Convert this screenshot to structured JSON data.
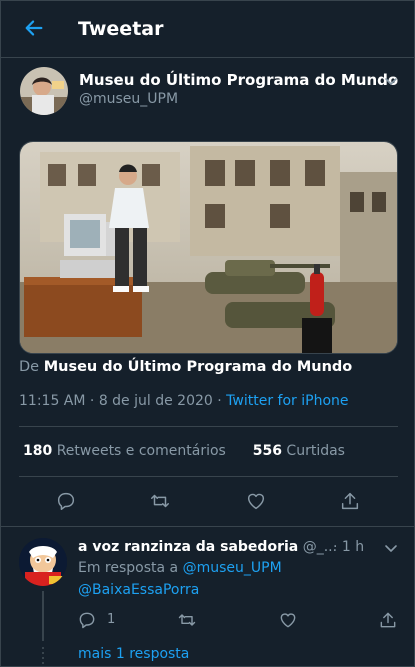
{
  "colors": {
    "background": "#15202b",
    "accent": "#1da1f2",
    "muted": "#8899a6",
    "border": "#38444d"
  },
  "header": {
    "back_icon": "arrow-left-icon",
    "title": "Tweetar"
  },
  "tweet": {
    "author_name": "Museu do Último Programa do Mundo",
    "author_handle": "@museu_UPM",
    "source_prefix": "De",
    "source_name": "Museu do Último Programa do Mundo",
    "time": "11:15 AM",
    "date": "8 de jul de 2020",
    "client": "Twitter for iPhone",
    "retweets_count": "180",
    "retweets_label": "Retweets e comentários",
    "likes_count": "556",
    "likes_label": "Curtidas",
    "actions": [
      "comment-icon",
      "retweet-icon",
      "like-icon",
      "share-icon"
    ]
  },
  "reply": {
    "author_name": "a voz ranzinza da sabedoria",
    "author_handle": "@_...",
    "time": "1 h",
    "in_reply_prefix": "Em resposta a",
    "in_reply_to": "@museu_UPM",
    "mention": "@BaixaEssaPorra",
    "reply_count": "1",
    "more_replies": "mais 1 resposta"
  }
}
